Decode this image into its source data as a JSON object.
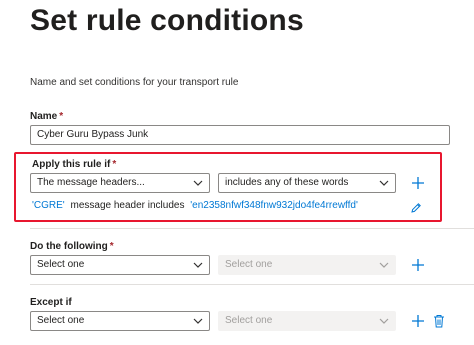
{
  "page": {
    "title": "Set rule conditions",
    "subtitle": "Name and set conditions for your transport rule"
  },
  "name_field": {
    "label": "Name",
    "required_mark": "*",
    "value": "Cyber Guru Bypass Junk"
  },
  "apply_rule": {
    "label": "Apply this rule if",
    "required_mark": "*",
    "condition_dropdown": "The message headers...",
    "operator_dropdown": "includes any of these words",
    "summary": {
      "header_value": "'CGRE'",
      "middle_text": "message header includes",
      "words_value": "'en2358nfwf348fnw932jdo4fe4rrewffd'"
    }
  },
  "do_following": {
    "label": "Do the following",
    "required_mark": "*",
    "action_dropdown": "Select one",
    "secondary_dropdown": "Select one"
  },
  "except_if": {
    "label": "Except if",
    "action_dropdown": "Select one",
    "secondary_dropdown": "Select one"
  },
  "colors": {
    "accent": "#0078d4",
    "highlight_border": "#e8172f",
    "required": "#a4262c"
  },
  "icons": [
    "chevron-down-icon",
    "plus-icon",
    "edit-pencil-icon",
    "delete-trash-icon"
  ]
}
